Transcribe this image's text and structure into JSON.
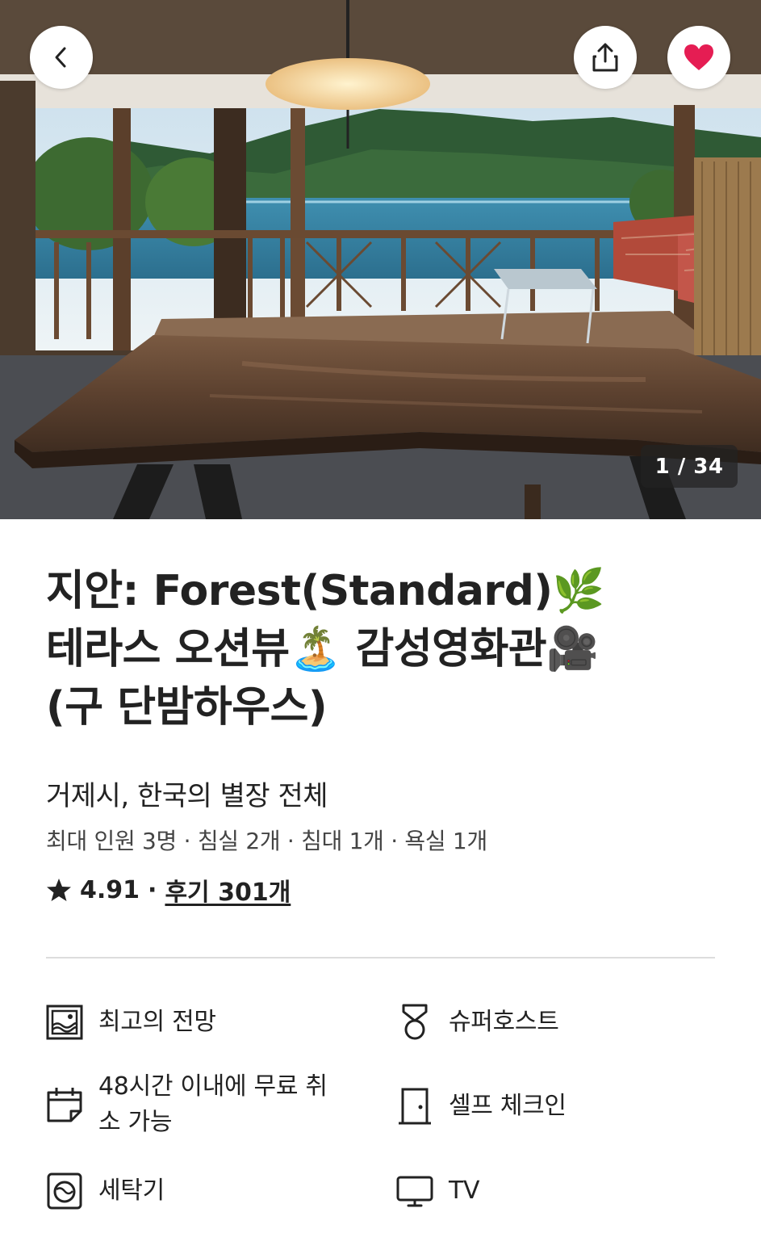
{
  "header": {
    "back_icon": "chevron-left-icon",
    "share_icon": "share-icon",
    "favorite_icon": "heart-icon",
    "favorite_color": "#E51D53",
    "photo_counter": "1 / 34"
  },
  "listing": {
    "title_line1": "지안: Forest(Standard)🌿",
    "title_line2": "테라스 오션뷰🏝️ 감성영화관🎥",
    "title_line3": "(구 단밤하우스)",
    "subtitle": "거제시, 한국의 별장 전체",
    "capacity": "최대 인원 3명 · 침실 2개 · 침대 1개 · 욕실 1개",
    "rating": "4.91",
    "rating_separator": "·",
    "reviews_link": "후기 301개"
  },
  "features": [
    {
      "icon": "picture-icon",
      "label": "최고의 전망"
    },
    {
      "icon": "medal-icon",
      "label": "슈퍼호스트"
    },
    {
      "icon": "calendar-icon",
      "label": "48시간 이내에 무료 취소 가능"
    },
    {
      "icon": "door-icon",
      "label": "셀프 체크인"
    },
    {
      "icon": "washer-icon",
      "label": "세탁기"
    },
    {
      "icon": "tv-icon",
      "label": "TV"
    }
  ]
}
